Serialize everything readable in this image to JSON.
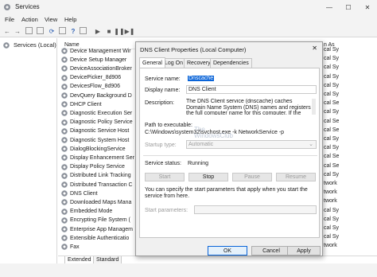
{
  "window": {
    "title": "Services",
    "min": "—",
    "max": "☐",
    "close": "✕"
  },
  "menu": [
    "File",
    "Action",
    "View",
    "Help"
  ],
  "left_pane": {
    "node_label": "Services (Local)"
  },
  "list": {
    "column_name": "Name",
    "rows": [
      "Device Management Wir",
      "Device Setup Manager",
      "DeviceAssociationBroker",
      "DevicePicker_8d906",
      "DevicesFlow_8d906",
      "DevQuery Background D",
      "DHCP Client",
      "Diagnostic Execution Ser",
      "Diagnostic Policy Service",
      "Diagnostic Service Host",
      "Diagnostic System Host",
      "DialogBlockingService",
      "Display Enhancement Ser",
      "Display Policy Service",
      "Distributed Link Tracking",
      "Distributed Transaction C",
      "DNS Client",
      "Downloaded Maps Mana",
      "Embedded Mode",
      "Encrypting File System (",
      "Enterprise App Managem",
      "Extensible Authenticatio",
      "Fax"
    ]
  },
  "right_col": {
    "header": "n As",
    "rows": [
      "cal Sy",
      "cal Sy",
      "cal Sy",
      "cal Sy",
      "cal Sy",
      "cal Sy",
      "cal Se",
      "cal Sy",
      "cal Se",
      "cal Se",
      "cal Sy",
      "cal Sy",
      "cal Se",
      "cal Se",
      "cal Sy",
      "twork",
      "twork",
      "twork",
      "cal Sy",
      "cal Sy",
      "cal Sy",
      "cal Sy",
      "twork"
    ]
  },
  "bottom_tabs": [
    "Extended",
    "Standard"
  ],
  "dialog": {
    "title": "DNS Client Properties (Local Computer)",
    "close": "✕",
    "tabs": [
      "General",
      "Log On",
      "Recovery",
      "Dependencies"
    ],
    "service_name_label": "Service name:",
    "service_name": "Dnscache",
    "display_name_label": "Display name:",
    "display_name": "DNS Client",
    "description_label": "Description:",
    "description": "The DNS Client service (dnscache) caches Domain Name System (DNS) names and registers the full computer name for this computer. If the service is",
    "path_label": "Path to executable:",
    "path": "C:\\Windows\\system32\\svchost.exe -k NetworkService -p",
    "startup_label": "Startup type:",
    "startup_value": "Automatic",
    "status_label": "Service status:",
    "status_value": "Running",
    "buttons": [
      "Start",
      "Stop",
      "Pause",
      "Resume"
    ],
    "hint": "You can specify the start parameters that apply when you start the service from here.",
    "start_params_label": "Start parameters:",
    "ok": "OK",
    "cancel": "Cancel",
    "apply": "Apply"
  },
  "watermark": {
    "line1": "The",
    "line2": "WindowsClub"
  }
}
